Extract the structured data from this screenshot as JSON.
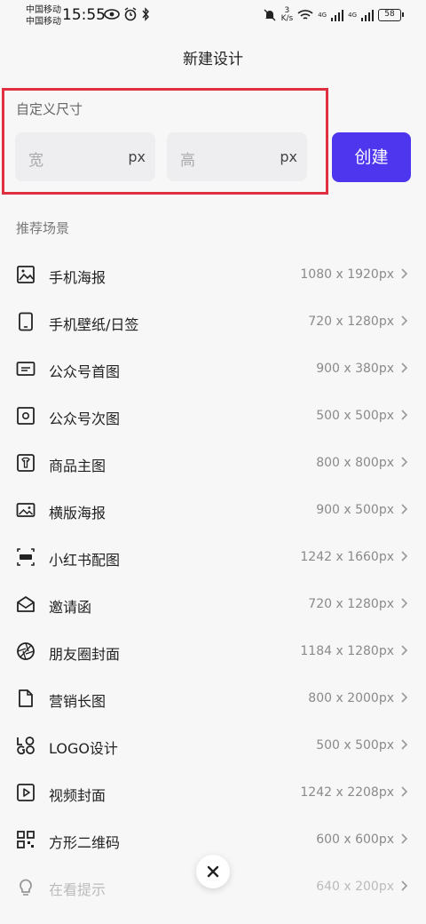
{
  "status_bar": {
    "carrier_1": "中国移动",
    "carrier_2": "中国移动",
    "time": "15:55",
    "net_speed_value": "3",
    "net_speed_unit": "K/s",
    "signal_1": "4G",
    "signal_2": "4G",
    "battery": "58"
  },
  "header": {
    "title": "新建设计"
  },
  "custom_size": {
    "label": "自定义尺寸",
    "width_placeholder": "宽",
    "height_placeholder": "高",
    "unit": "px",
    "create_label": "创建",
    "accent_color": "#4d36ee",
    "highlight_color": "#e0303f"
  },
  "recommended": {
    "label": "推荐场景",
    "items": [
      {
        "name": "手机海报",
        "size": "1080 x 1920px",
        "icon": "image-icon"
      },
      {
        "name": "手机壁纸/日签",
        "size": "720 x 1280px",
        "icon": "phone-icon"
      },
      {
        "name": "公众号首图",
        "size": "900 x 380px",
        "icon": "banner-icon"
      },
      {
        "name": "公众号次图",
        "size": "500 x 500px",
        "icon": "square-icon"
      },
      {
        "name": "商品主图",
        "size": "800 x 800px",
        "icon": "shirt-icon"
      },
      {
        "name": "横版海报",
        "size": "900 x 500px",
        "icon": "landscape-image-icon"
      },
      {
        "name": "小红书配图",
        "size": "1242 x 1660px",
        "icon": "xiaohongshu-icon"
      },
      {
        "name": "邀请函",
        "size": "720 x 1280px",
        "icon": "envelope-icon"
      },
      {
        "name": "朋友圈封面",
        "size": "1184 x 1280px",
        "icon": "aperture-icon"
      },
      {
        "name": "营销长图",
        "size": "800 x 2000px",
        "icon": "document-icon"
      },
      {
        "name": "LOGO设计",
        "size": "500 x 500px",
        "icon": "logo-icon"
      },
      {
        "name": "视频封面",
        "size": "1242 x 2208px",
        "icon": "video-icon"
      },
      {
        "name": "方形二维码",
        "size": "600 x 600px",
        "icon": "qrcode-icon"
      },
      {
        "name": "在看提示",
        "size": "640 x 200px",
        "icon": "lightbulb-icon"
      }
    ]
  },
  "close_button": {
    "icon": "close-icon"
  }
}
